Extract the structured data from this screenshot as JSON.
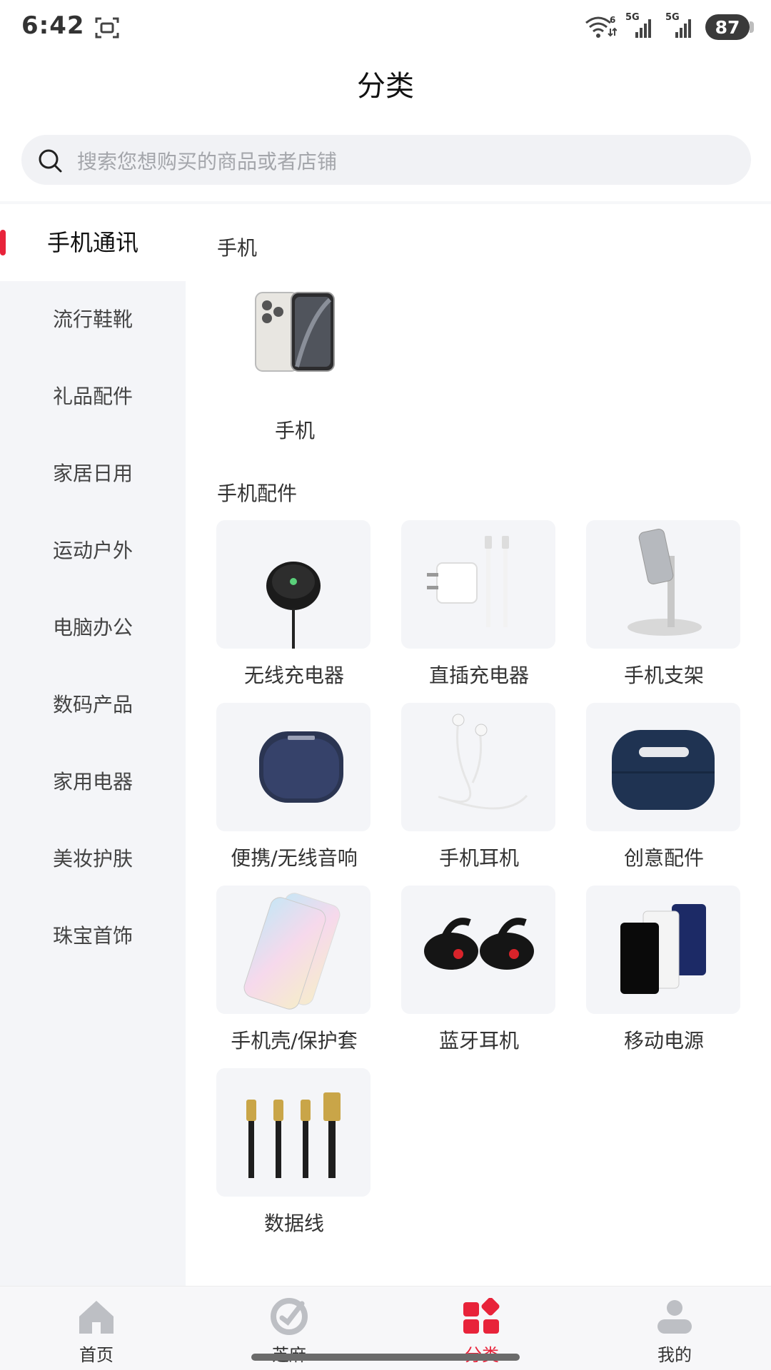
{
  "status_bar": {
    "time": "6:42",
    "signal_1": "5G",
    "signal_2": "5G",
    "battery": "87"
  },
  "header": {
    "title": "分类",
    "search_placeholder": "搜索您想购买的商品或者店铺"
  },
  "sidebar": {
    "items": [
      {
        "label": "手机通讯",
        "active": true
      },
      {
        "label": "流行鞋靴"
      },
      {
        "label": "礼品配件"
      },
      {
        "label": "家居日用"
      },
      {
        "label": "运动户外"
      },
      {
        "label": "电脑办公"
      },
      {
        "label": "数码产品"
      },
      {
        "label": "家用电器"
      },
      {
        "label": "美妆护肤"
      },
      {
        "label": "珠宝首饰"
      }
    ]
  },
  "sections": [
    {
      "title": "手机",
      "items": [
        {
          "label": "手机",
          "icon": "smartphone-image"
        }
      ]
    },
    {
      "title": "手机配件",
      "items": [
        {
          "label": "无线充电器",
          "icon": "wireless-charger-image"
        },
        {
          "label": "直插充电器",
          "icon": "wall-charger-image"
        },
        {
          "label": "手机支架",
          "icon": "phone-stand-image"
        },
        {
          "label": "便携/无线音响",
          "icon": "speaker-image"
        },
        {
          "label": "手机耳机",
          "icon": "wired-earphones-image"
        },
        {
          "label": "创意配件",
          "icon": "earbuds-case-image"
        },
        {
          "label": "手机壳/保护套",
          "icon": "phone-case-image"
        },
        {
          "label": "蓝牙耳机",
          "icon": "bluetooth-earbuds-image"
        },
        {
          "label": "移动电源",
          "icon": "power-bank-image"
        },
        {
          "label": "数据线",
          "icon": "cables-image"
        }
      ]
    }
  ],
  "bottom_nav": {
    "items": [
      {
        "label": "首页",
        "icon": "home-icon"
      },
      {
        "label": "芝麻",
        "icon": "sesame-icon"
      },
      {
        "label": "分类",
        "icon": "category-icon",
        "active": true
      },
      {
        "label": "我的",
        "icon": "profile-icon"
      }
    ]
  },
  "colors": {
    "accent": "#e8233a",
    "sidebar_bg": "#f4f5f8",
    "search_bg": "#f1f2f5"
  }
}
